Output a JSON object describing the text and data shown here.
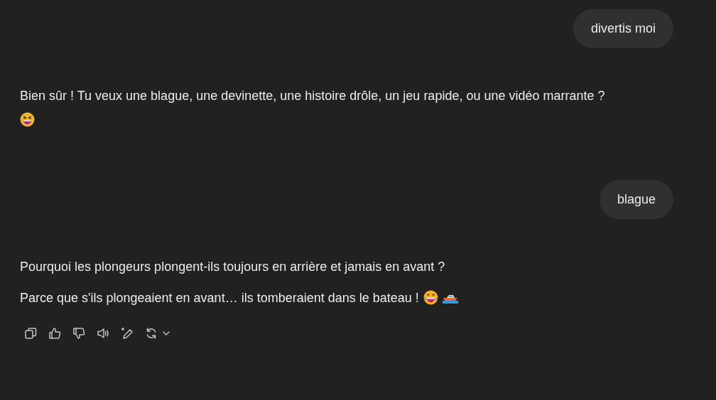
{
  "messages": [
    {
      "kind": "user",
      "text": "divertis moi"
    },
    {
      "kind": "assistant",
      "paragraphs": [
        {
          "text": "Bien sûr ! Tu veux une blague, une devinette, une histoire drôle, un jeu rapide, ou une vidéo marrante ?",
          "icon_line": [
            {
              "kind": "squint-laugh"
            }
          ]
        }
      ]
    },
    {
      "kind": "user",
      "text": "blague"
    },
    {
      "kind": "assistant",
      "paragraphs": [
        {
          "text": "Pourquoi les plongeurs plongent-ils toujours en arrière et jamais en avant ?"
        },
        {
          "text": "Parce que s'ils plongeaient en avant… ils tomberaient dans le bateau !",
          "icons": [
            {
              "kind": "tears-laugh"
            },
            {
              "kind": "boat"
            }
          ]
        }
      ],
      "actions": [
        {
          "kind": "copy"
        },
        {
          "kind": "like"
        },
        {
          "kind": "dislike"
        },
        {
          "kind": "speaker"
        },
        {
          "kind": "edit"
        },
        {
          "kind": "regenerate"
        }
      ]
    }
  ]
}
